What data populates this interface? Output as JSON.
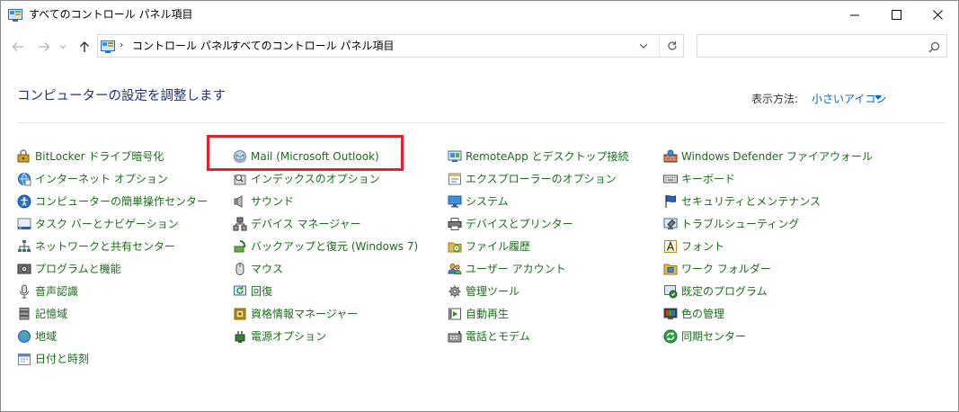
{
  "window": {
    "title": "すべてのコントロール パネル項目",
    "minimize_glyph": "—",
    "colors": {
      "link": "#1a6e1a",
      "title": "#1e3287",
      "accent": "#0066cc",
      "highlight": "#e0202a"
    }
  },
  "address": {
    "breadcrumbs": [
      "コントロール パネル",
      "すべてのコントロール パネル項目"
    ],
    "separator": "›"
  },
  "search": {
    "placeholder": "",
    "value": ""
  },
  "header": {
    "title": "コンピューターの設定を調整します",
    "view_label": "表示方法:",
    "view_value": "小さいアイコン"
  },
  "columns": [
    {
      "items": [
        {
          "label": "BitLocker ドライブ暗号化",
          "icon": "bitlocker-icon"
        },
        {
          "label": "インターネット オプション",
          "icon": "internet-options-icon"
        },
        {
          "label": "コンピューターの簡単操作センター",
          "icon": "ease-of-access-icon"
        },
        {
          "label": "タスク バーとナビゲーション",
          "icon": "taskbar-icon"
        },
        {
          "label": "ネットワークと共有センター",
          "icon": "network-icon"
        },
        {
          "label": "プログラムと機能",
          "icon": "programs-icon"
        },
        {
          "label": "音声認識",
          "icon": "microphone-icon"
        },
        {
          "label": "記憶域",
          "icon": "storage-icon"
        },
        {
          "label": "地域",
          "icon": "region-icon"
        },
        {
          "label": "日付と時刻",
          "icon": "calendar-icon"
        }
      ]
    },
    {
      "items": [
        {
          "label": "Mail (Microsoft Outlook)",
          "icon": "mail-icon"
        },
        {
          "label": "インデックスのオプション",
          "icon": "indexing-icon"
        },
        {
          "label": "サウンド",
          "icon": "speaker-icon"
        },
        {
          "label": "デバイス マネージャー",
          "icon": "device-manager-icon"
        },
        {
          "label": "バックアップと復元 (Windows 7)",
          "icon": "backup-icon"
        },
        {
          "label": "マウス",
          "icon": "mouse-icon"
        },
        {
          "label": "回復",
          "icon": "recovery-icon"
        },
        {
          "label": "資格情報マネージャー",
          "icon": "credential-icon"
        },
        {
          "label": "電源オプション",
          "icon": "power-icon"
        }
      ]
    },
    {
      "items": [
        {
          "label": "RemoteApp とデスクトップ接続",
          "icon": "remoteapp-icon"
        },
        {
          "label": "エクスプローラーのオプション",
          "icon": "folder-options-icon"
        },
        {
          "label": "システム",
          "icon": "system-icon"
        },
        {
          "label": "デバイスとプリンター",
          "icon": "printer-icon"
        },
        {
          "label": "ファイル履歴",
          "icon": "file-history-icon"
        },
        {
          "label": "ユーザー アカウント",
          "icon": "users-icon"
        },
        {
          "label": "管理ツール",
          "icon": "admin-tools-icon"
        },
        {
          "label": "自動再生",
          "icon": "autoplay-icon"
        },
        {
          "label": "電話とモデム",
          "icon": "phone-modem-icon"
        }
      ]
    },
    {
      "items": [
        {
          "label": "Windows Defender ファイアウォール",
          "icon": "firewall-icon"
        },
        {
          "label": "キーボード",
          "icon": "keyboard-icon"
        },
        {
          "label": "セキュリティとメンテナンス",
          "icon": "flag-icon"
        },
        {
          "label": "トラブルシューティング",
          "icon": "troubleshoot-icon"
        },
        {
          "label": "フォント",
          "icon": "font-icon"
        },
        {
          "label": "ワーク フォルダー",
          "icon": "work-folders-icon"
        },
        {
          "label": "既定のプログラム",
          "icon": "default-programs-icon"
        },
        {
          "label": "色の管理",
          "icon": "color-management-icon"
        },
        {
          "label": "同期センター",
          "icon": "sync-icon"
        }
      ]
    }
  ]
}
